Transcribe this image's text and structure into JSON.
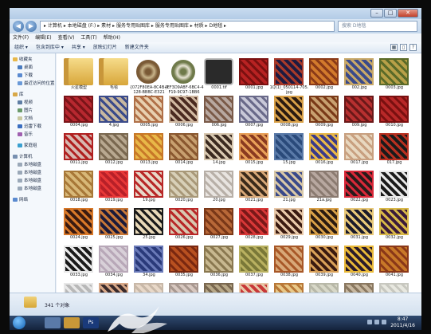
{
  "window": {
    "minimize": "–",
    "maximize": "□",
    "close": "✕"
  },
  "nav": {
    "back": "◀",
    "forward": "▶"
  },
  "address": {
    "path": "▸ 计算机 ▸ 本地磁盘 (F:) ▸ 素材 ▸ 服务专用贴图库 ▸ 服务专用贴图库 ▸ 材质 ▸ D地毯 ▸"
  },
  "search": {
    "placeholder": "搜索 D地毯"
  },
  "menu": [
    "文件(F)",
    "编辑(E)",
    "查看(V)",
    "工具(T)",
    "帮助(H)"
  ],
  "toolbar": [
    "组织 ▾",
    "包含到库中 ▾",
    "共享 ▾",
    "放映幻灯片",
    "新建文件夹"
  ],
  "sidebar": [
    {
      "label": "收藏夹",
      "icon": "star-icon",
      "color": "#e8b84a"
    },
    {
      "label": "桌面",
      "icon": "desktop-icon",
      "color": "#4a7cc0"
    },
    {
      "label": "下载",
      "icon": "download-icon",
      "color": "#5a8ad0"
    },
    {
      "label": "最近访问的位置",
      "icon": "recent-icon",
      "color": "#6a9ad8"
    },
    {
      "label": "库",
      "icon": "library-icon",
      "color": "#d8a848"
    },
    {
      "label": "视频",
      "icon": "video-icon",
      "color": "#5f7ea4"
    },
    {
      "label": "图片",
      "icon": "picture-icon",
      "color": "#6a9a6a"
    },
    {
      "label": "文档",
      "icon": "document-icon",
      "color": "#c8c8a0"
    },
    {
      "label": "迅雷下载",
      "icon": "thunder-icon",
      "color": "#3a6ec0"
    },
    {
      "label": "音乐",
      "icon": "music-icon",
      "color": "#a060b0"
    },
    {
      "label": "家庭组",
      "icon": "homegroup-icon",
      "color": "#3aa0d0"
    },
    {
      "label": "计算机",
      "icon": "computer-icon",
      "color": "#7890b0"
    },
    {
      "label": "本地磁盘",
      "icon": "drive-icon",
      "color": "#9aa8b8"
    },
    {
      "label": "本地磁盘",
      "icon": "drive-icon",
      "color": "#9aa8b8"
    },
    {
      "label": "本地磁盘",
      "icon": "drive-icon",
      "color": "#9aa8b8"
    },
    {
      "label": "本地磁盘",
      "icon": "drive-icon",
      "color": "#9aa8b8"
    },
    {
      "label": "网络",
      "icon": "network-icon",
      "color": "#5a8ad0"
    }
  ],
  "files": [
    {
      "name": "火星模型",
      "kind": "folder"
    },
    {
      "name": "毛毯",
      "kind": "folder"
    },
    {
      "name": "{072F80EA-8C4B-4128-BBBC-E3215...}",
      "kind": "round",
      "c1": "#c8b48a",
      "c2": "#7a5a36"
    },
    {
      "name": "{EF3D9ABF-6BC4-4F19-9C97-1BB6A...}",
      "kind": "round",
      "c1": "#e8e4d4",
      "c2": "#6f7a4a"
    },
    {
      "name": "0001.tif",
      "kind": "tif"
    },
    {
      "name": "0001.jpg",
      "c1": "#b82222",
      "c2": "#7a1010"
    },
    {
      "name": "1Q(1)_050114-705.jpg",
      "c1": "#1e1a40",
      "c2": "#a83a2a"
    },
    {
      "name": "0002.jpg",
      "c1": "#d27a2c",
      "c2": "#8a3a18"
    },
    {
      "name": "002.jpg",
      "c1": "#3a4a8a",
      "c2": "#c8a868"
    },
    {
      "name": "0003.jpg",
      "c1": "#b8a048",
      "c2": "#5a6a28"
    },
    {
      "name": "0004.jpg",
      "c1": "#b82830",
      "c2": "#7a1418"
    },
    {
      "name": "4.jpg",
      "c1": "#c8b8a0",
      "c2": "#3a4a8a"
    },
    {
      "name": "0005.jpg",
      "c1": "#e8d0b0",
      "c2": "#b07048"
    },
    {
      "name": "0006.jpg",
      "c1": "#4a2a20",
      "c2": "#d0b8a0"
    },
    {
      "name": "006.jpg",
      "c1": "#b8a8a0",
      "c2": "#7a5a48"
    },
    {
      "name": "0007.jpg",
      "c1": "#c8c8d8",
      "c2": "#6a6a8a"
    },
    {
      "name": "0008.jpg",
      "c1": "#2a1a10",
      "c2": "#d8a048"
    },
    {
      "name": "0009.jpg",
      "c1": "#c8a070",
      "c2": "#7a3a18"
    },
    {
      "name": "009.jpg",
      "c1": "#b83030",
      "c2": "#6a1818"
    },
    {
      "name": "0010.jpg",
      "c1": "#b82828",
      "c2": "#7a1010"
    },
    {
      "name": "0011.jpg",
      "c1": "#d8b8b0",
      "c2": "#b02020"
    },
    {
      "name": "0012.jpg",
      "c1": "#b8a890",
      "c2": "#7a6850"
    },
    {
      "name": "0013.jpg",
      "c1": "#e8b848",
      "c2": "#c87828"
    },
    {
      "name": "0014.jpg",
      "c1": "#c8a070",
      "c2": "#8a5830"
    },
    {
      "name": "14.jpg",
      "c1": "#3a2a20",
      "c2": "#d8c8b0"
    },
    {
      "name": "0015.jpg",
      "c1": "#8a3a20",
      "c2": "#e8a058"
    },
    {
      "name": "15.jpg",
      "c1": "#2a4a7a",
      "c2": "#5a7aa8"
    },
    {
      "name": "0016.jpg",
      "c1": "#3a3a8a",
      "c2": "#e8b848"
    },
    {
      "name": "0017.jpg",
      "c1": "#e8d8c0",
      "c2": "#c8a080"
    },
    {
      "name": "017.jpg",
      "c1": "#1a1a1a",
      "c2": "#b83020"
    },
    {
      "name": "0018.jpg",
      "c1": "#d8b878",
      "c2": "#a87838"
    },
    {
      "name": "0019.jpg",
      "c1": "#b82028",
      "c2": "#e83838"
    },
    {
      "name": "19.jpg",
      "c1": "#e8d8c8",
      "c2": "#b82828"
    },
    {
      "name": "0020.jpg",
      "c1": "#d8d0b8",
      "c2": "#a89878"
    },
    {
      "name": "20.jpg",
      "c1": "#e8e4e0",
      "c2": "#b8b0a8"
    },
    {
      "name": "0021.jpg",
      "c1": "#3a2a1a",
      "c2": "#d8a878"
    },
    {
      "name": "21.jpg",
      "c1": "#3a4a8a",
      "c2": "#d8c8a8"
    },
    {
      "name": "21a.jpg",
      "c1": "#b8a8a0",
      "c2": "#8a7a70"
    },
    {
      "name": "0022.jpg",
      "c1": "#2a1a1a",
      "c2": "#d82838"
    },
    {
      "name": "0023.jpg",
      "c1": "#1a1a1a",
      "c2": "#e8e8e8"
    },
    {
      "name": "0024.jpg",
      "c1": "#3a1a10",
      "c2": "#d87828"
    },
    {
      "name": "0025.jpg",
      "c1": "#1a1a3a",
      "c2": "#c87838"
    },
    {
      "name": "25.jpg",
      "c1": "#e8d8b8",
      "c2": "#1a1a1a"
    },
    {
      "name": "0026.jpg",
      "c1": "#d8c8b0",
      "c2": "#b82828"
    },
    {
      "name": "0027.jpg",
      "c1": "#b86838",
      "c2": "#7a3818"
    },
    {
      "name": "0028.jpg",
      "c1": "#7a1818",
      "c2": "#d83838"
    },
    {
      "name": "0029.jpg",
      "c1": "#3a1a10",
      "c2": "#e8c8a8"
    },
    {
      "name": "0030.jpg",
      "c1": "#2a1a10",
      "c2": "#d8a048"
    },
    {
      "name": "0031.jpg",
      "c1": "#1a1a2a",
      "c2": "#e8c878"
    },
    {
      "name": "0032.jpg",
      "c1": "#3a1a3a",
      "c2": "#d8b848"
    },
    {
      "name": "0033.jpg",
      "c1": "#1a1a1a",
      "c2": "#e8e8e8"
    },
    {
      "name": "0034.jpg",
      "c1": "#d8d0d8",
      "c2": "#b8a8b8"
    },
    {
      "name": "34.jpg",
      "c1": "#2a3a7a",
      "c2": "#6a7ab8"
    },
    {
      "name": "0035.jpg",
      "c1": "#b85020",
      "c2": "#7a2810"
    },
    {
      "name": "0036.jpg",
      "c1": "#c8b890",
      "c2": "#8a7850"
    },
    {
      "name": "0037.jpg",
      "c1": "#7a7838",
      "c2": "#b8b060"
    },
    {
      "name": "0038.jpg",
      "c1": "#d8a878",
      "c2": "#a85828"
    },
    {
      "name": "0039.jpg",
      "c1": "#3a1a10",
      "c2": "#d8a058"
    },
    {
      "name": "0040.jpg",
      "c1": "#2a1a2a",
      "c2": "#e8b838"
    },
    {
      "name": "0041.jpg",
      "c1": "#c87828",
      "c2": "#8a3818"
    },
    {
      "name": "",
      "c1": "#b8b8b8",
      "c2": "#e8e8e8"
    },
    {
      "name": "",
      "c1": "#3a2a2a",
      "c2": "#d8a888"
    },
    {
      "name": "",
      "c1": "#e8d8c8",
      "c2": "#c8b8a8"
    },
    {
      "name": "",
      "c1": "#d8c8c0",
      "c2": "#a89890"
    },
    {
      "name": "",
      "c1": "#b8a888",
      "c2": "#7a6850"
    },
    {
      "name": "",
      "c1": "#c83838",
      "c2": "#e8c8a8"
    },
    {
      "name": "",
      "c1": "#e8c888",
      "c2": "#b87838"
    },
    {
      "name": "",
      "c1": "#d8d8c8",
      "c2": "#b8b8a8"
    },
    {
      "name": "",
      "c1": "#c8b8a0",
      "c2": "#8a7860"
    },
    {
      "name": "",
      "c1": "#e8e8e0",
      "c2": "#c8c8c0"
    }
  ],
  "status": {
    "count": "341 个对象"
  },
  "taskbar": {
    "time": "8:47",
    "date": "2011/4/16",
    "ps_label": "Ps"
  }
}
